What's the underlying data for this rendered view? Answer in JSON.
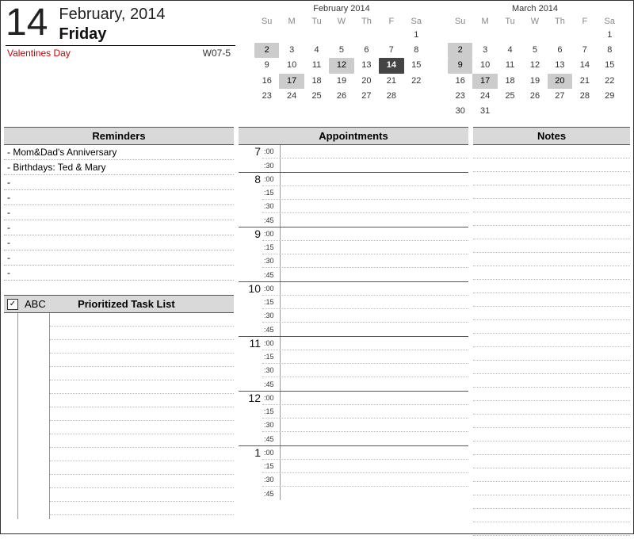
{
  "date": {
    "dayNumber": "14",
    "monthYear": "February, 2014",
    "weekday": "Friday",
    "eventName": "Valentines Day",
    "weekCode": "W07-5"
  },
  "miniCalendars": [
    {
      "title": "February 2014",
      "dowHeaders": [
        "Su",
        "M",
        "Tu",
        "W",
        "Th",
        "F",
        "Sa"
      ],
      "weeks": [
        [
          "",
          "",
          "",
          "",
          "",
          "",
          "1"
        ],
        [
          "2",
          "3",
          "4",
          "5",
          "6",
          "7",
          "8"
        ],
        [
          "9",
          "10",
          "11",
          "12",
          "13",
          "14",
          "15"
        ],
        [
          "16",
          "17",
          "18",
          "19",
          "20",
          "21",
          "22"
        ],
        [
          "23",
          "24",
          "25",
          "26",
          "27",
          "28",
          ""
        ]
      ],
      "highlights": {
        "today": "14",
        "selected": [
          "2",
          "12",
          "17"
        ]
      }
    },
    {
      "title": "March 2014",
      "dowHeaders": [
        "Su",
        "M",
        "Tu",
        "W",
        "Th",
        "F",
        "Sa"
      ],
      "weeks": [
        [
          "",
          "",
          "",
          "",
          "",
          "",
          "1"
        ],
        [
          "2",
          "3",
          "4",
          "5",
          "6",
          "7",
          "8"
        ],
        [
          "9",
          "10",
          "11",
          "12",
          "13",
          "14",
          "15"
        ],
        [
          "16",
          "17",
          "18",
          "19",
          "20",
          "21",
          "22"
        ],
        [
          "23",
          "24",
          "25",
          "26",
          "27",
          "28",
          "29"
        ],
        [
          "30",
          "31",
          "",
          "",
          "",
          "",
          ""
        ]
      ],
      "highlights": {
        "today": "",
        "selected": [
          "2",
          "9",
          "17",
          "20"
        ]
      }
    }
  ],
  "sections": {
    "remindersTitle": "Reminders",
    "appointmentsTitle": "Appointments",
    "notesTitle": "Notes",
    "taskListTitle": "Prioritized Task List",
    "taskAbcLabel": "ABC",
    "taskCheckGlyph": "☑"
  },
  "reminders": [
    "- Mom&Dad's Anniversary",
    "- Birthdays: Ted & Mary",
    "-",
    "-",
    "-",
    "-",
    "-",
    "-",
    "-"
  ],
  "appointments": [
    {
      "hour": "7",
      "minutes": [
        ":00",
        ":30"
      ]
    },
    {
      "hour": "8",
      "minutes": [
        ":00",
        ":15",
        ":30",
        ":45"
      ]
    },
    {
      "hour": "9",
      "minutes": [
        ":00",
        ":15",
        ":30",
        ":45"
      ]
    },
    {
      "hour": "10",
      "minutes": [
        ":00",
        ":15",
        ":30",
        ":45"
      ]
    },
    {
      "hour": "11",
      "minutes": [
        ":00",
        ":15",
        ":30",
        ":45"
      ]
    },
    {
      "hour": "12",
      "minutes": [
        ":00",
        ":15",
        ":30",
        ":45"
      ]
    },
    {
      "hour": "1",
      "minutes": [
        ":00",
        ":15",
        ":30",
        ":45"
      ]
    }
  ],
  "notesLineCount": 29,
  "taskRowCount": 15
}
